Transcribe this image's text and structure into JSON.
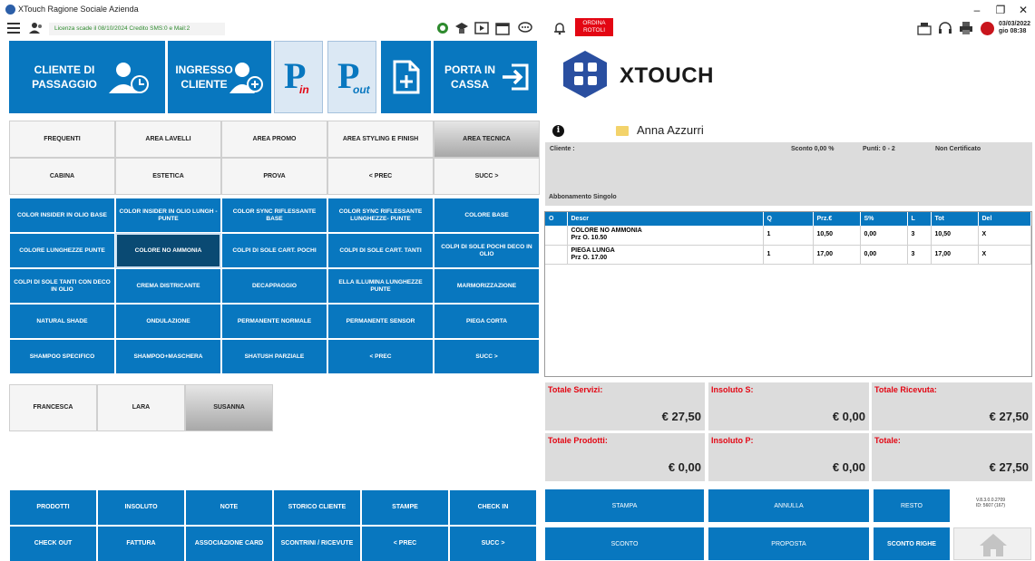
{
  "window": {
    "title": "XTouch Ragione Sociale Azienda"
  },
  "toolbar": {
    "license_text": "Licenza scade il 08/10/2024   Credito SMS:0  e  Mail:2",
    "ordina_rotoli": "ORDINA ROTOLI",
    "date": "03/03/2022",
    "time": "gio  08:38"
  },
  "big_buttons": {
    "cliente_passaggio": "CLIENTE DI PASSAGGIO",
    "ingresso_cliente": "INGRESSO CLIENTE",
    "p_in": {
      "letter": "P",
      "sub": "in"
    },
    "p_out": {
      "letter": "P",
      "sub": "out"
    },
    "porta_cassa": "PORTA IN CASSA"
  },
  "categories": [
    "FREQUENTI",
    "AREA LAVELLI",
    "AREA PROMO",
    "AREA STYLING E FINISH",
    "AREA TECNICA",
    "CABINA",
    "ESTETICA",
    "PROVA",
    "< PREC",
    "SUCC >"
  ],
  "services": [
    "COLOR INSIDER IN OLIO BASE",
    "COLOR INSIDER IN OLIO LUNGH -PUNTE",
    "COLOR SYNC RIFLESSANTE BASE",
    "COLOR SYNC RIFLESSANTE LUNGHEZZE- PUNTE",
    "COLORE BASE",
    "COLORE LUNGHEZZE PUNTE",
    "COLORE NO AMMONIA",
    "COLPI DI SOLE CART. POCHI",
    "COLPI DI SOLE CART. TANTI",
    "COLPI DI SOLE POCHI DECO IN OLIO",
    "COLPI DI SOLE TANTI CON DECO IN OLIO",
    "CREMA DISTRICANTE",
    "DECAPPAGGIO",
    "ELLA ILLUMINA LUNGHEZZE PUNTE",
    "MARMORIZZAZIONE",
    "NATURAL SHADE",
    "ONDULAZIONE",
    "PERMANENTE NORMALE",
    "PERMANENTE SENSOR",
    "PIEGA CORTA",
    "SHAMPOO SPECIFICO",
    "SHAMPOO+MASCHERA",
    "SHATUSH PARZIALE",
    "< PREC",
    "SUCC >"
  ],
  "operators": [
    "FRANCESCA",
    "LARA",
    "SUSANNA"
  ],
  "bottom_buttons": [
    "PRODOTTI",
    "INSOLUTO",
    "NOTE",
    "STORICO CLIENTE",
    "STAMPE",
    "CHECK IN",
    "CHECK OUT",
    "FATTURA",
    "ASSOCIAZIONE CARD",
    "SCONTRINI / RICEVUTE",
    "< PREC",
    "SUCC >"
  ],
  "brand": {
    "name": "XTOUCH"
  },
  "client": {
    "name": "Anna Azzurri",
    "cliente_label": "Cliente :",
    "sconto": "Sconto 0,00 %",
    "punti": "Punti: 0 - 2",
    "certificato": "Non Certificato",
    "abbonamento": "Abbonamento Singolo"
  },
  "table": {
    "headers": [
      "O",
      "Descr",
      "Q",
      "Prz.€",
      "S%",
      "L",
      "Tot",
      "Del"
    ],
    "rows": [
      {
        "o": "",
        "name": "COLORE NO AMMONIA",
        "price_note": "Prz O. 10.50",
        "q": "1",
        "prz": "10,50",
        "s": "0,00",
        "l": "3",
        "tot": "10,50",
        "del": "X"
      },
      {
        "o": "",
        "name": "PIEGA LUNGA",
        "price_note": "Prz O. 17.00",
        "q": "1",
        "prz": "17,00",
        "s": "0,00",
        "l": "3",
        "tot": "17,00",
        "del": "X"
      }
    ]
  },
  "totals": {
    "servizi": {
      "label": "Totale Servizi:",
      "value": "€ 27,50"
    },
    "insoluto_s": {
      "label": "Insoluto S:",
      "value": "€ 0,00"
    },
    "ricevuta": {
      "label": "Totale Ricevuta:",
      "value": "€ 27,50"
    },
    "prodotti": {
      "label": "Totale Prodotti:",
      "value": "€ 0,00"
    },
    "insoluto_p": {
      "label": "Insoluto P:",
      "value": "€ 0,00"
    },
    "totale": {
      "label": "Totale:",
      "value": "€ 27,50"
    }
  },
  "actions": {
    "stampa": "STAMPA",
    "annulla": "ANNULLA",
    "resto": "RESTO",
    "sconto": "SCONTO",
    "proposta": "PROPOSTA",
    "sconto_righe": "SCONTO RIGHE"
  },
  "version": {
    "line1": "V.8.3.0.0.2709",
    "line2": "ID: 5607 (167)"
  },
  "colors": {
    "primary_blue": "#0877bf",
    "dark_blue": "#0a4a73",
    "alert_red": "#e30613",
    "panel_grey": "#dcdcdc"
  }
}
